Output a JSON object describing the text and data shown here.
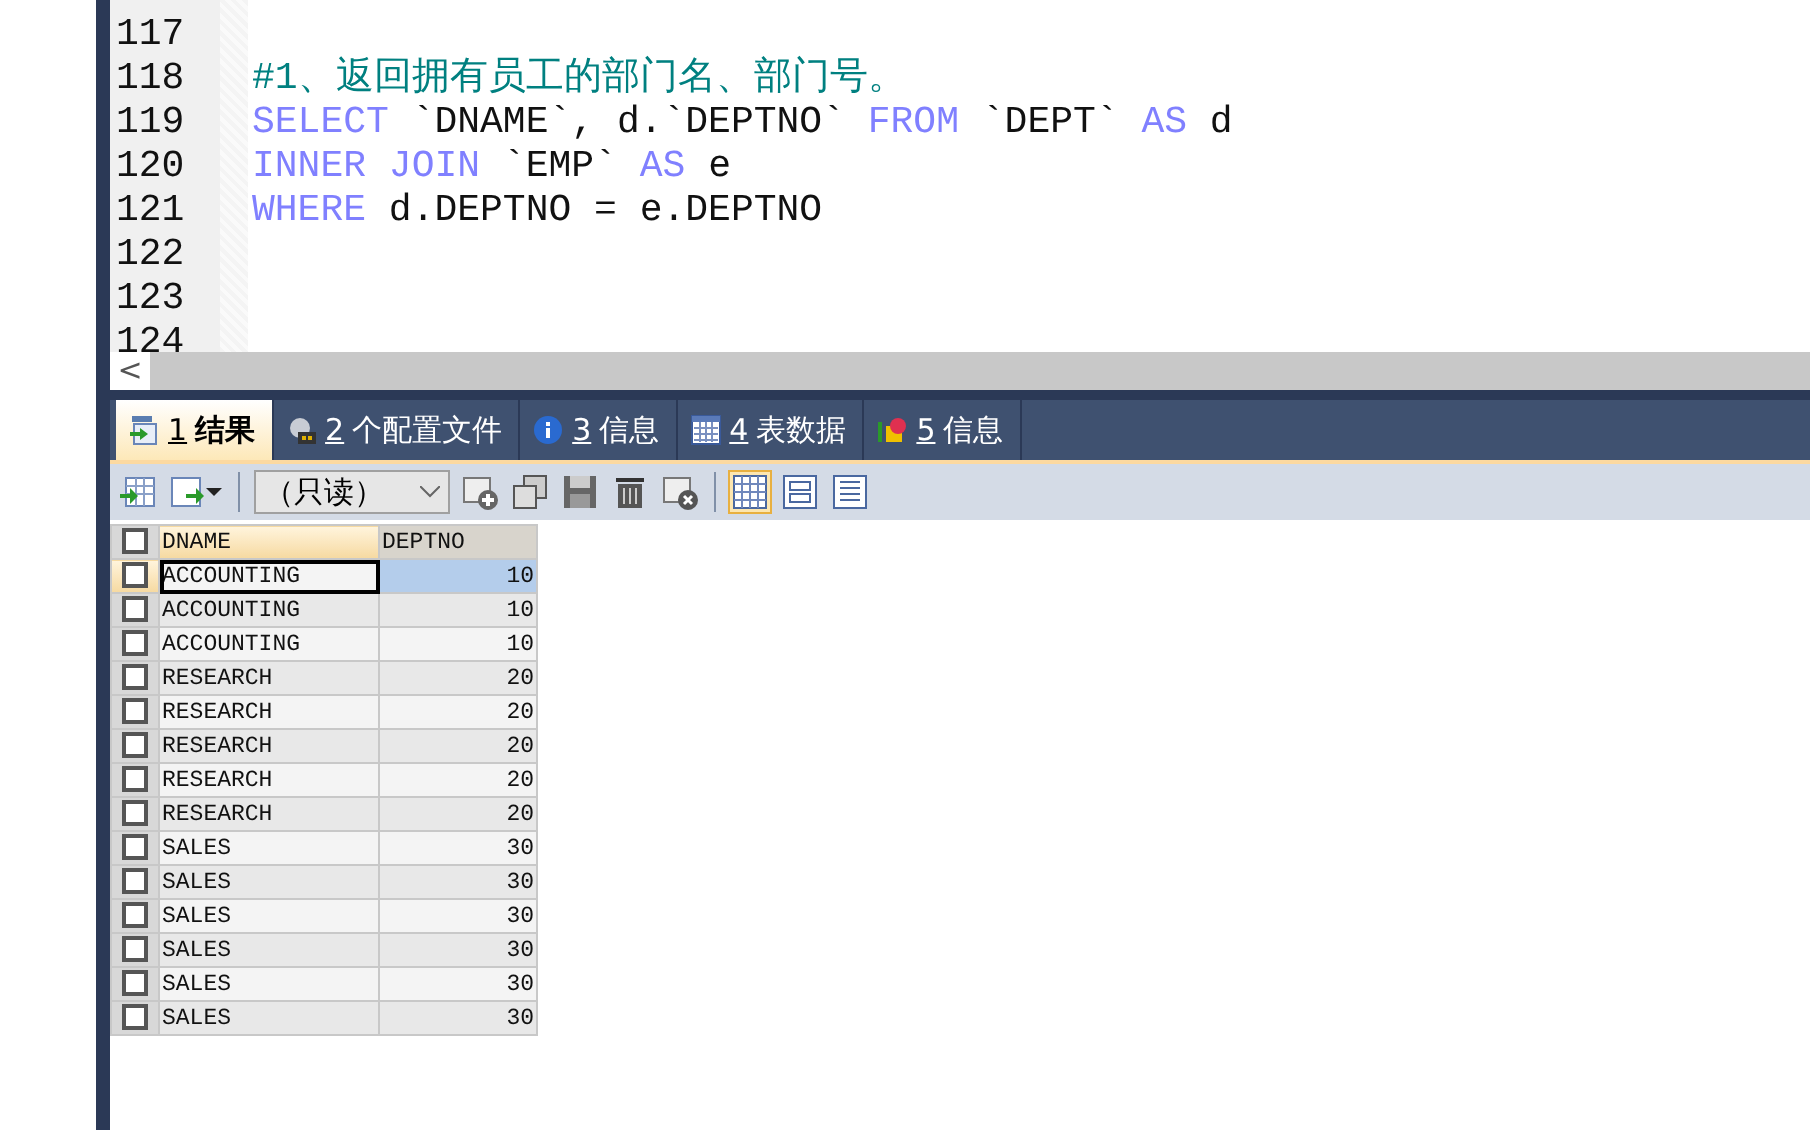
{
  "editor": {
    "lines": [
      {
        "number": "117"
      },
      {
        "number": "118",
        "tokens": [
          {
            "kind": "comment",
            "text": "#1、返回拥有员工的部门名、部门号。"
          }
        ]
      },
      {
        "number": "119",
        "tokens": [
          {
            "kind": "keyword",
            "text": "SELECT"
          },
          {
            "kind": "plain",
            "text": " `DNAME`, d.`DEPTNO` "
          },
          {
            "kind": "keyword",
            "text": "FROM"
          },
          {
            "kind": "plain",
            "text": " `DEPT` "
          },
          {
            "kind": "keyword",
            "text": "AS"
          },
          {
            "kind": "plain",
            "text": " d"
          }
        ]
      },
      {
        "number": "120",
        "tokens": [
          {
            "kind": "keyword",
            "text": "INNER JOIN"
          },
          {
            "kind": "plain",
            "text": " `EMP` "
          },
          {
            "kind": "keyword",
            "text": "AS"
          },
          {
            "kind": "plain",
            "text": " e"
          }
        ]
      },
      {
        "number": "121",
        "tokens": [
          {
            "kind": "keyword",
            "text": "WHERE"
          },
          {
            "kind": "plain",
            "text": " d.DEPTNO = e.DEPTNO"
          }
        ]
      },
      {
        "number": "122"
      },
      {
        "number": "123"
      },
      {
        "number": "124"
      }
    ],
    "scroll_left": "<"
  },
  "tabs": [
    {
      "key": "1",
      "label": "结果",
      "selected": true
    },
    {
      "key": "2",
      "label": "个配置文件",
      "selected": false
    },
    {
      "key": "3",
      "label": "信息",
      "selected": false
    },
    {
      "key": "4",
      "label": "表数据",
      "selected": false
    },
    {
      "key": "5",
      "label": "信息",
      "selected": false
    }
  ],
  "toolbar": {
    "mode": "（只读）",
    "views": [
      {
        "selected": true
      },
      {
        "selected": false
      },
      {
        "selected": false
      }
    ]
  },
  "table": {
    "header_checked": false,
    "columns": [
      {
        "label": "DNAME",
        "kind": "text",
        "active": true
      },
      {
        "label": "DEPTNO",
        "kind": "number",
        "active": false
      }
    ],
    "rows": [
      {
        "cells": [
          "ACCOUNTING",
          "10"
        ],
        "selected": true,
        "checked": false
      },
      {
        "cells": [
          "ACCOUNTING",
          "10"
        ],
        "selected": false,
        "checked": false
      },
      {
        "cells": [
          "ACCOUNTING",
          "10"
        ],
        "selected": false,
        "checked": false
      },
      {
        "cells": [
          "RESEARCH",
          "20"
        ],
        "selected": false,
        "checked": false
      },
      {
        "cells": [
          "RESEARCH",
          "20"
        ],
        "selected": false,
        "checked": false
      },
      {
        "cells": [
          "RESEARCH",
          "20"
        ],
        "selected": false,
        "checked": false
      },
      {
        "cells": [
          "RESEARCH",
          "20"
        ],
        "selected": false,
        "checked": false
      },
      {
        "cells": [
          "RESEARCH",
          "20"
        ],
        "selected": false,
        "checked": false
      },
      {
        "cells": [
          "SALES",
          "30"
        ],
        "selected": false,
        "checked": false
      },
      {
        "cells": [
          "SALES",
          "30"
        ],
        "selected": false,
        "checked": false
      },
      {
        "cells": [
          "SALES",
          "30"
        ],
        "selected": false,
        "checked": false
      },
      {
        "cells": [
          "SALES",
          "30"
        ],
        "selected": false,
        "checked": false
      },
      {
        "cells": [
          "SALES",
          "30"
        ],
        "selected": false,
        "checked": false
      },
      {
        "cells": [
          "SALES",
          "30"
        ],
        "selected": false,
        "checked": false
      }
    ]
  }
}
